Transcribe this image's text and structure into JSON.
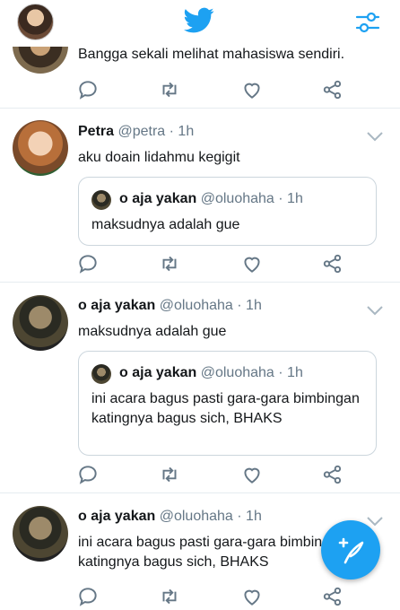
{
  "header": {
    "profile_icon": "avatar",
    "logo_icon": "twitter-bird-icon",
    "filter_icon": "sliders-icon",
    "brand_color": "#1da1f2"
  },
  "tweets": [
    {
      "text": "Bangga sekali melihat mahasiswa sendiri.",
      "partial": true
    },
    {
      "name": "Petra",
      "handle": "@petra",
      "time": "· 1h",
      "text": "aku doain lidahmu kegigit",
      "quote": {
        "name": "o aja yakan",
        "handle": "@oluohaha",
        "time": "· 1h",
        "text": "maksudnya adalah gue"
      }
    },
    {
      "name": "o aja yakan",
      "handle": "@oluohaha",
      "time": "· 1h",
      "text": "maksudnya adalah gue",
      "quote": {
        "name": "o aja yakan",
        "handle": "@oluohaha",
        "time": "· 1h",
        "text": "ini acara bagus pasti gara-gara bimbingan katingnya bagus sich, BHAKS"
      }
    },
    {
      "name": "o aja yakan",
      "handle": "@oluohaha",
      "time": "· 1h",
      "text": "ini acara bagus pasti gara-gara bimbingan katingnya bagus sich, BHAKS"
    }
  ],
  "actions": [
    "reply-icon",
    "retweet-icon",
    "like-icon",
    "share-icon"
  ],
  "compose": {
    "icon": "compose-feather-icon"
  }
}
